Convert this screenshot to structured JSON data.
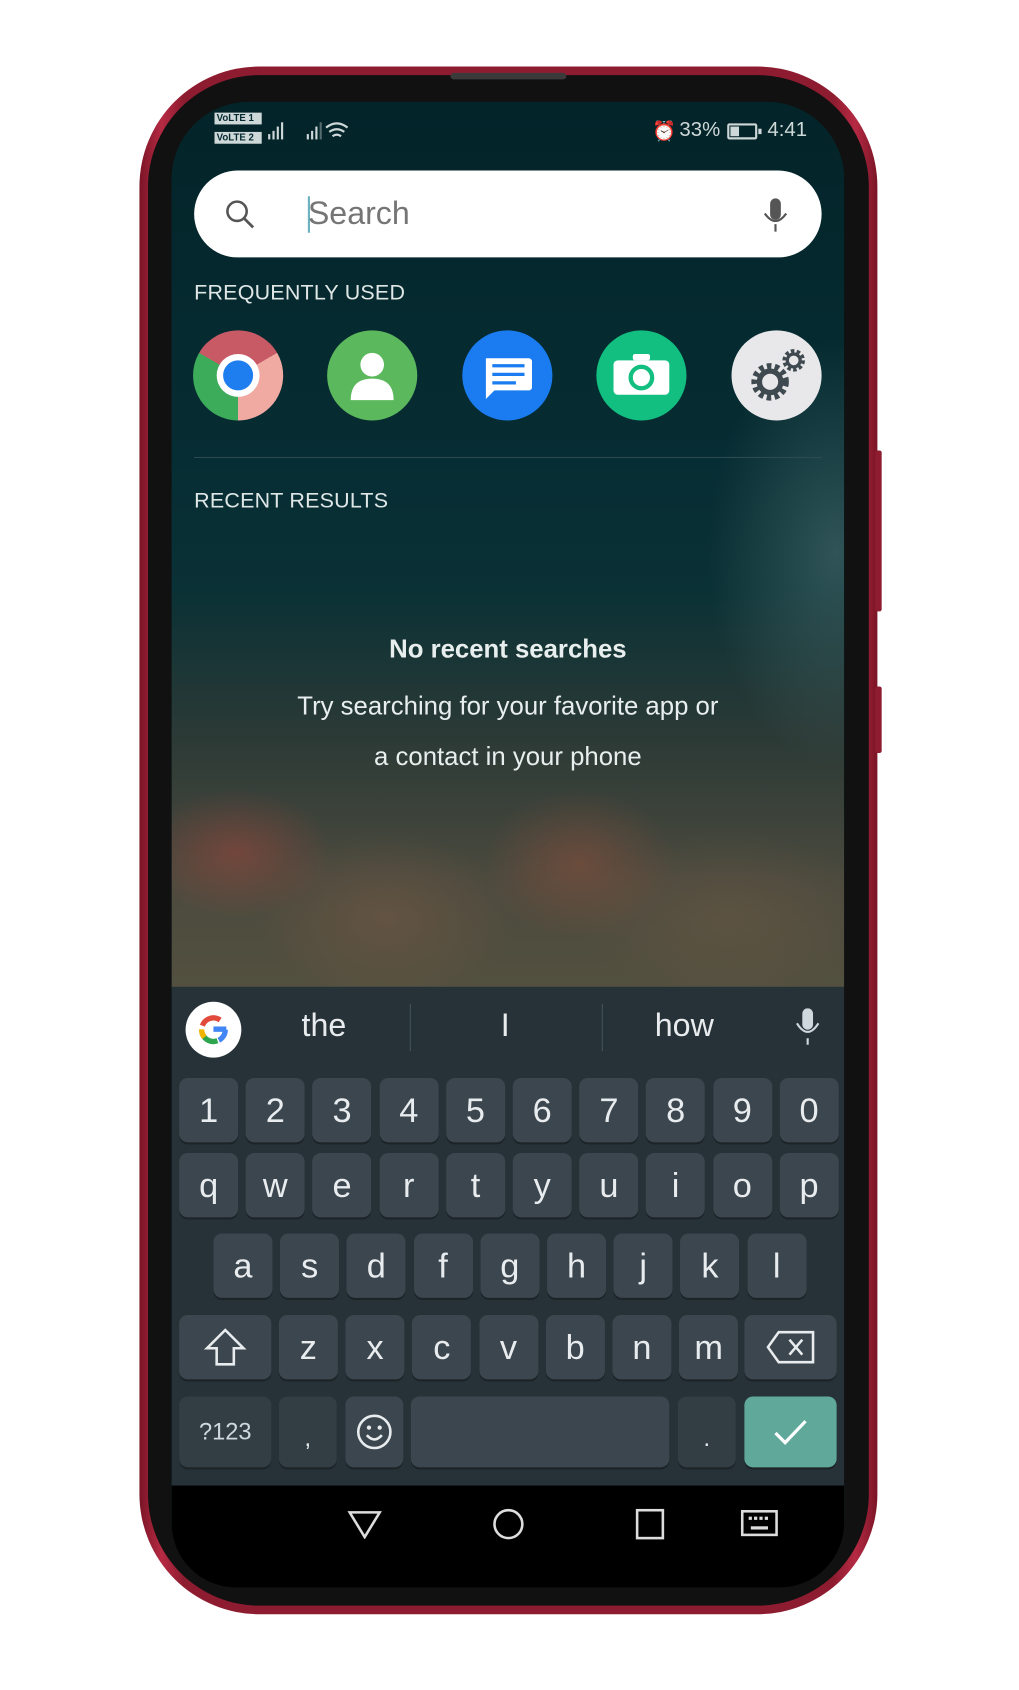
{
  "status_bar": {
    "sim1": "VoLTE 1",
    "sim2": "VoLTE 2",
    "battery": "33%",
    "time": "4:41",
    "icons": [
      "signal-icon",
      "signal-icon",
      "wifi-icon",
      "alarm-icon",
      "battery-icon"
    ]
  },
  "search": {
    "placeholder": "Search",
    "icon": "search-icon",
    "mic": "mic-icon"
  },
  "frequently_used": {
    "label": "FREQUENTLY USED",
    "apps": [
      {
        "icon": "chrome-icon",
        "color": "#e6574a"
      },
      {
        "icon": "contact-icon",
        "color": "#5cb85c"
      },
      {
        "icon": "message-icon",
        "color": "#1a7cf0"
      },
      {
        "icon": "camera-icon",
        "color": "#12bf80"
      },
      {
        "icon": "settings-gear-icon",
        "color": "#e8e8ea"
      }
    ]
  },
  "recent": {
    "label": "RECENT RESULTS",
    "empty_title": "No recent searches",
    "empty_line1": "Try searching for your favorite app or",
    "empty_line2": "a contact in your phone"
  },
  "keyboard": {
    "suggestions": [
      "the",
      "I",
      "how"
    ],
    "rows": [
      [
        "1",
        "2",
        "3",
        "4",
        "5",
        "6",
        "7",
        "8",
        "9",
        "0"
      ],
      [
        "q",
        "w",
        "e",
        "r",
        "t",
        "y",
        "u",
        "i",
        "o",
        "p"
      ],
      [
        "a",
        "s",
        "d",
        "f",
        "g",
        "h",
        "j",
        "k",
        "l"
      ],
      [
        "z",
        "x",
        "c",
        "v",
        "b",
        "n",
        "m"
      ]
    ],
    "symbols_key": "?123",
    "comma": ",",
    "period": ".",
    "enter_color": "#5fa89a"
  },
  "nav": [
    "back-icon",
    "home-icon",
    "recents-icon",
    "keyboard-icon"
  ]
}
